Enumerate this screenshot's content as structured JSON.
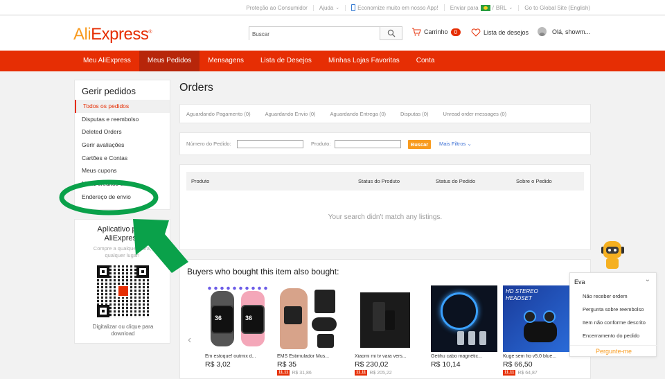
{
  "topbar": {
    "consumer": "Proteção ao Consumidor",
    "help": "Ajuda",
    "app": "Economize muito em nosso App!",
    "ship_to": "Enviar para",
    "currency": "BRL",
    "global": "Go to Global Site (English)"
  },
  "header": {
    "logo_a": "Ali",
    "logo_b": "Express",
    "search_placeholder": "Buscar",
    "cart_label": "Carrinho",
    "cart_count": "0",
    "wishlist_label": "Lista de desejos",
    "greeting": "Olá, showm..."
  },
  "nav": {
    "items": [
      "Meu AliExpress",
      "Meus Pedidos",
      "Mensagens",
      "Lista de Desejos",
      "Minhas Lojas Favoritas",
      "Conta"
    ],
    "active_index": 1
  },
  "sidebar": {
    "title": "Gerir pedidos",
    "items": [
      "Todos os pedidos",
      "Disputas e reembolso",
      "Deleted Orders",
      "Gerir avaliações",
      "Cartões e Contas",
      "Meus cupons",
      "Meus créditos em",
      "Endereço de envio"
    ]
  },
  "app_promo": {
    "title_line1": "Aplicativo para",
    "title_line2": "AliExpress",
    "subtitle_line1": "Compre a qualquer hora,",
    "subtitle_line2": "qualquer lugar!",
    "caption_line1": "Digitalizar ou clique para",
    "caption_line2": "download"
  },
  "main": {
    "title": "Orders",
    "tabs": [
      "Aguardando Pagamento (0)",
      "Aguardando Envio (0)",
      "Aguardando Entrega (0)",
      "Disputas (0)",
      "Unread order messages (0)"
    ],
    "filters": {
      "order_label": "Número do Pedido:",
      "product_label": "Produto:",
      "search_button": "Buscar",
      "more_filters": "Mais Filtros"
    },
    "table_headers": [
      "Produto",
      "Status do Produto",
      "Status do Pedido",
      "Sobre o Pedido"
    ],
    "empty_message": "Your search didn't match any listings."
  },
  "recommendations": {
    "title": "Buyers who bought this item also bought:",
    "products": [
      {
        "name": "Em estoque! outmix d...",
        "price": "R$ 3,02",
        "old": ""
      },
      {
        "name": "EMS Estimulador Mus...",
        "price": "R$ 35",
        "old": "R$ 31,86"
      },
      {
        "name": "Xiaomi mi tv vara vers...",
        "price": "R$ 230,02",
        "old": "R$ 205,22"
      },
      {
        "name": "Getihu cabo magnétic...",
        "price": "R$ 10,14",
        "old": ""
      },
      {
        "name": "Kuge sem fio v5.0 blue...",
        "price": "R$ 66,50",
        "old": "R$ 64,87"
      }
    ],
    "sale_tag": "11.11",
    "ear_text_line1": "HD STEREO",
    "ear_text_line2": "HEADSET"
  },
  "chat": {
    "title": "Eva",
    "options": [
      "Não receber ordem",
      "Pergunta sobre reembolso",
      "Item não conforme descrito",
      "Encerramento do pedido"
    ],
    "ask_button": "Pergunte-me"
  },
  "colors": {
    "brand_red": "#e62e04",
    "brand_orange": "#f89b1f",
    "annotation_green": "#0aa14a"
  },
  "icons": [
    "phone-icon",
    "flag-brazil-icon",
    "search-icon",
    "cart-icon",
    "heart-icon",
    "avatar-icon",
    "chevron-down-icon",
    "chevron-left-icon",
    "robot-icon"
  ]
}
